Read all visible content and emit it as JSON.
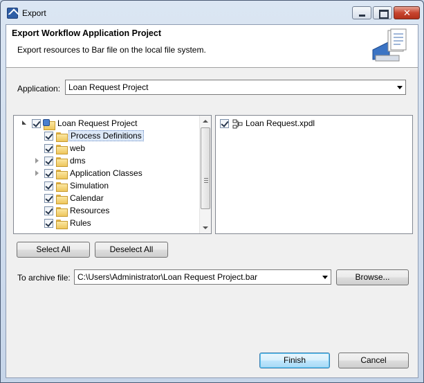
{
  "window": {
    "title": "Export",
    "controls": {
      "minimize": "minimize",
      "maximize": "maximize",
      "close": "✕"
    }
  },
  "banner": {
    "title": "Export Workflow Application Project",
    "description": "Export resources to Bar file on the local file system."
  },
  "application": {
    "label": "Application:",
    "selected": "Loan Request Project"
  },
  "tree": {
    "root": "Loan Request Project",
    "items": [
      {
        "label": "Process Definitions",
        "selected": true,
        "expandable": false
      },
      {
        "label": "web",
        "expandable": false
      },
      {
        "label": "dms",
        "expandable": true
      },
      {
        "label": "Application Classes",
        "expandable": true
      },
      {
        "label": "Simulation",
        "expandable": false
      },
      {
        "label": "Calendar",
        "expandable": false
      },
      {
        "label": "Resources",
        "expandable": false
      },
      {
        "label": "Rules",
        "expandable": false
      }
    ]
  },
  "files": {
    "items": [
      {
        "label": "Loan Request.xpdl"
      }
    ]
  },
  "selection_buttons": {
    "select_all": "Select All",
    "deselect_all": "Deselect All"
  },
  "archive": {
    "label": "To archive file:",
    "value": "C:\\Users\\Administrator\\Loan Request Project.bar",
    "browse": "Browse..."
  },
  "footer": {
    "finish": "Finish",
    "cancel": "Cancel"
  }
}
